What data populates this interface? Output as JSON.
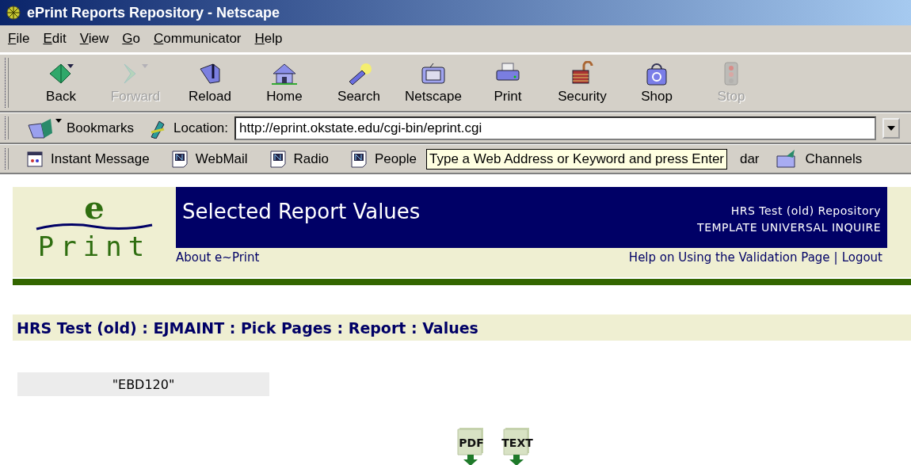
{
  "window": {
    "title": "ePrint Reports Repository - Netscape"
  },
  "menu": [
    "File",
    "Edit",
    "View",
    "Go",
    "Communicator",
    "Help"
  ],
  "toolbar": [
    {
      "label": "Back",
      "disabled": false
    },
    {
      "label": "Forward",
      "disabled": true
    },
    {
      "label": "Reload",
      "disabled": false
    },
    {
      "label": "Home",
      "disabled": false
    },
    {
      "label": "Search",
      "disabled": false
    },
    {
      "label": "Netscape",
      "disabled": false
    },
    {
      "label": "Print",
      "disabled": false
    },
    {
      "label": "Security",
      "disabled": false
    },
    {
      "label": "Shop",
      "disabled": false
    },
    {
      "label": "Stop",
      "disabled": true
    }
  ],
  "location_bar": {
    "bookmarks": "Bookmarks",
    "label": "Location:",
    "value": "http://eprint.okstate.edu/cgi-bin/eprint.cgi"
  },
  "personal_toolbar": [
    "Instant Message",
    "WebMail",
    "Radio",
    "People",
    "dar",
    "Channels"
  ],
  "tooltip": "Type a Web Address or Keyword and press Enter",
  "page": {
    "logo": {
      "top": "e",
      "bottom": "Print"
    },
    "title": "Selected Report Values",
    "repository": "HRS Test (old) Repository",
    "template": "TEMPLATE UNIVERSAL INQUIRE",
    "links_left": [
      "About e~Print"
    ],
    "links_right": [
      "Help on Using the Validation Page",
      "|",
      "Logout"
    ],
    "breadcrumb": "HRS Test (old) : EJMAINT : Pick Pages : Report : Values",
    "value": "\"EBD120\"",
    "downloads": [
      "PDF",
      "TEXT"
    ]
  }
}
